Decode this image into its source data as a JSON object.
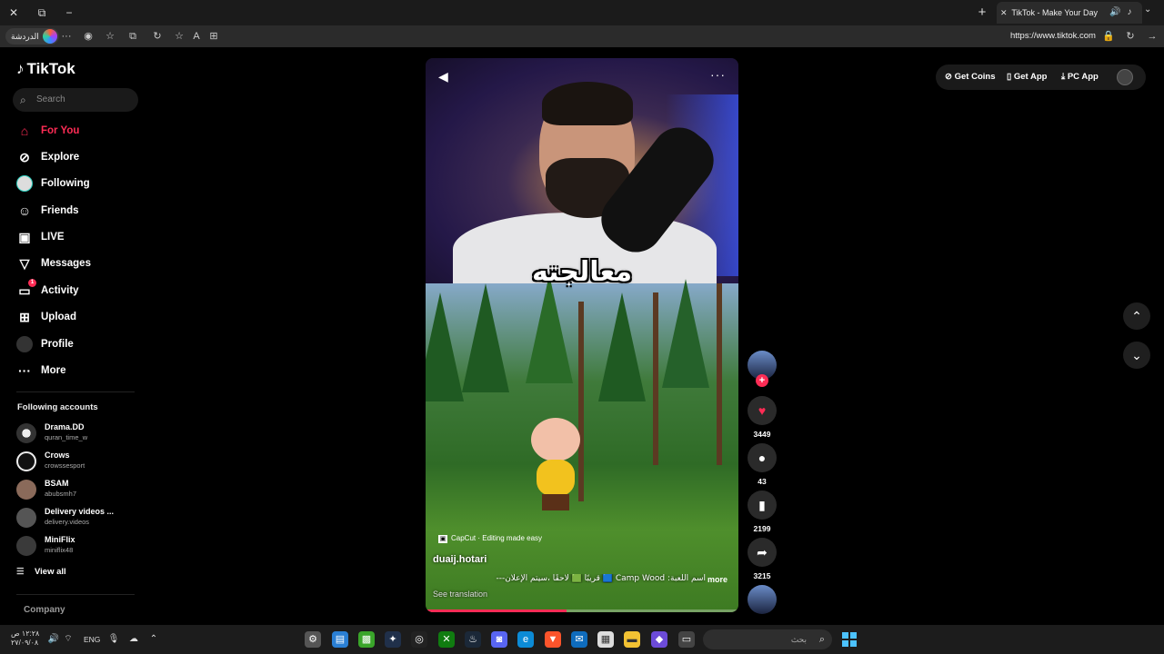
{
  "window": {
    "close": "✕",
    "restore": "⧉",
    "minimize": "−",
    "new_tab": "+"
  },
  "tab": {
    "close": "✕",
    "title": "TikTok - Make Your Day",
    "menu": "⌄"
  },
  "toolbar": {
    "copilot_label": "الدردشة",
    "more": "···",
    "url": "https://www.tiktok.com"
  },
  "sidebar": {
    "logo_text": "TikTok",
    "search_placeholder": "Search",
    "nav": [
      {
        "label": "For You",
        "icon": "home-icon"
      },
      {
        "label": "Explore",
        "icon": "compass-icon"
      },
      {
        "label": "Following",
        "icon": "following-avatar-icon"
      },
      {
        "label": "Friends",
        "icon": "friends-icon"
      },
      {
        "label": "LIVE",
        "icon": "live-icon"
      },
      {
        "label": "Messages",
        "icon": "send-icon"
      },
      {
        "label": "Activity",
        "icon": "activity-icon",
        "badge": "1"
      },
      {
        "label": "Upload",
        "icon": "upload-icon"
      },
      {
        "label": "Profile",
        "icon": "profile-avatar-icon"
      },
      {
        "label": "More",
        "icon": "more-dots-icon"
      }
    ],
    "following_title": "Following accounts",
    "accounts": [
      {
        "name": "Drama.DD",
        "handle": "quran_time_w"
      },
      {
        "name": "Crows",
        "handle": "crowssesport"
      },
      {
        "name": "BSAM",
        "handle": "abubsmh7"
      },
      {
        "name": "Delivery videos ...",
        "handle": "delivery.videos"
      },
      {
        "name": "MiniFlix",
        "handle": "miniflix48"
      }
    ],
    "view_all": "View all",
    "company": "Company"
  },
  "video": {
    "caption_overlay": "معالجته",
    "capcut": "CapCut · Editing made easy",
    "author": "duaij.hotari",
    "description": "اسم اللعبة: Camp Wood 🟦 قريبًا 🟩 لاحقًا ،سيتم الإعلان---",
    "more": "more",
    "see_translation": "See translation",
    "progress": 0.45
  },
  "actions": {
    "likes": "3449",
    "comments": "43",
    "saves": "2199",
    "shares": "3215"
  },
  "topbar": {
    "get_coins": "Get Coins",
    "get_app": "Get App",
    "pc_app": "PC App"
  },
  "taskbar": {
    "time": "١٢:٢٨ ص",
    "date": "٢٧/٠٩/٠٨",
    "lang": "ENG",
    "search_placeholder": "بحث"
  },
  "colors": {
    "accent": "#fe2c55",
    "background": "#000000"
  }
}
